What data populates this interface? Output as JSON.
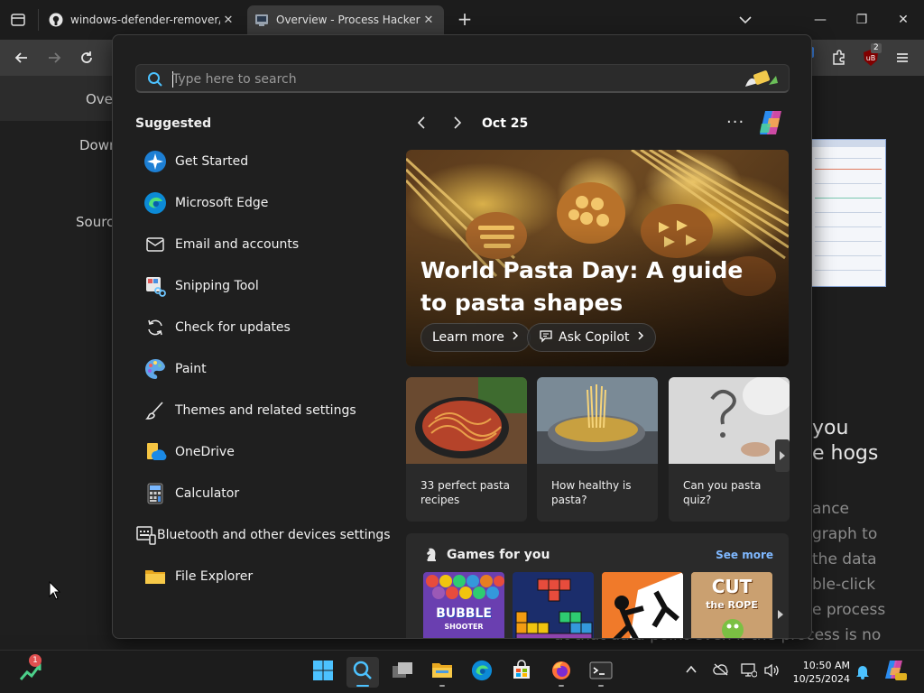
{
  "browser": {
    "tabs": [
      {
        "label": "windows-defender-remover/Sc",
        "icon": "github-icon"
      },
      {
        "label": "Overview - Process Hacker",
        "icon": "process-hacker-icon",
        "active": true
      }
    ],
    "new_tab": "+",
    "window": {
      "minimize": "—",
      "maximize": "❐",
      "close": "✕"
    },
    "extension_badge": "2"
  },
  "page": {
    "nav": {
      "overview": "Overv",
      "downloads": "Down",
      "source": "Source"
    },
    "body_right": {
      "line1": "you",
      "line2": "e hogs"
    },
    "body_gray": [
      "ance",
      "graph to",
      "the data",
      "ble-click",
      "e process",
      "at that data point even if the process is no"
    ]
  },
  "flyout": {
    "search": {
      "placeholder": "Type here to search",
      "value": ""
    },
    "suggested_title": "Suggested",
    "suggested": [
      {
        "label": "Get Started",
        "icon": "get-started-icon"
      },
      {
        "label": "Microsoft Edge",
        "icon": "edge-icon"
      },
      {
        "label": "Email and accounts",
        "icon": "mail-icon"
      },
      {
        "label": "Snipping Tool",
        "icon": "snipping-tool-icon"
      },
      {
        "label": "Check for updates",
        "icon": "refresh-icon"
      },
      {
        "label": "Paint",
        "icon": "paint-icon"
      },
      {
        "label": "Themes and related settings",
        "icon": "brush-icon"
      },
      {
        "label": "OneDrive",
        "icon": "onedrive-icon"
      },
      {
        "label": "Calculator",
        "icon": "calculator-icon"
      },
      {
        "label": "Bluetooth and other devices settings",
        "icon": "devices-icon"
      },
      {
        "label": "File Explorer",
        "icon": "folder-icon"
      }
    ],
    "date": "Oct 25",
    "more": "···",
    "hero": {
      "title": "World Pasta Day: A guide to pasta shapes",
      "learn_more": "Learn more",
      "ask_copilot": "Ask Copilot"
    },
    "cards": [
      {
        "caption": "33 perfect pasta recipes"
      },
      {
        "caption": "How healthy is pasta?"
      },
      {
        "caption": "Can you pasta quiz?"
      }
    ],
    "games": {
      "title": "Games for you",
      "see_more": "See more",
      "items": [
        {
          "title": "BUBBLE",
          "subtitle": "SHOOTER"
        },
        {
          "title": "Tetris-style blocks"
        },
        {
          "title": "Stickman fighter"
        },
        {
          "title": "CUT",
          "subtitle": "the ROPE"
        }
      ]
    }
  },
  "taskbar": {
    "notification_badge": "1",
    "clock": {
      "time": "10:50 AM",
      "date": "10/25/2024"
    }
  }
}
